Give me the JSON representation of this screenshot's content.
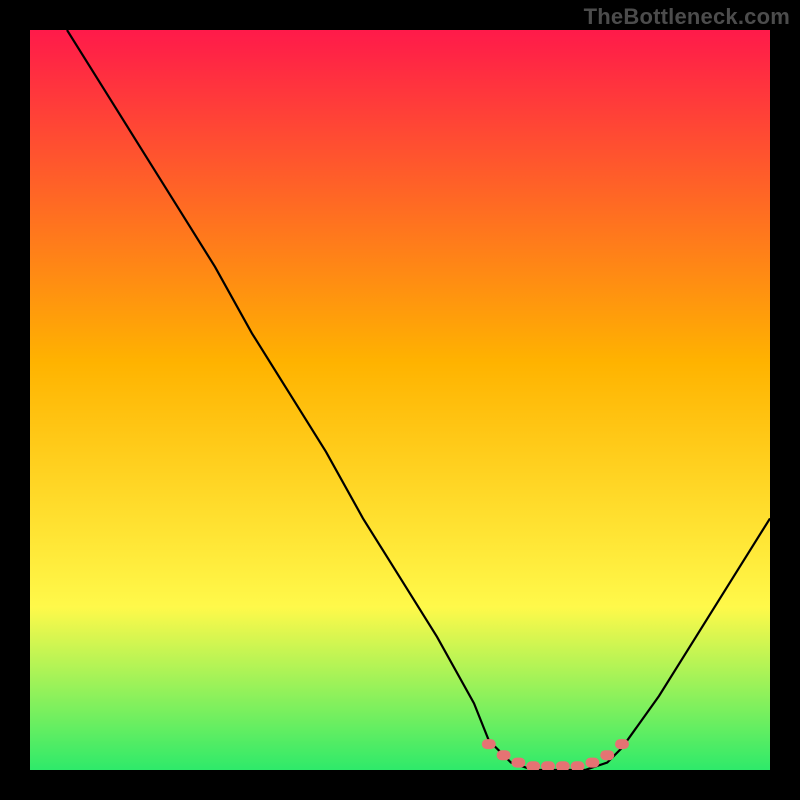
{
  "watermark": "TheBottleneck.com",
  "chart_data": {
    "type": "line",
    "title": "",
    "xlabel": "",
    "ylabel": "",
    "xlim": [
      0,
      100
    ],
    "ylim": [
      0,
      100
    ],
    "grid": false,
    "legend": false,
    "background_gradient": {
      "top": "#ff1a4a",
      "mid1": "#ffb300",
      "mid2": "#fff94a",
      "bottom": "#2eea6a"
    },
    "series": [
      {
        "name": "bottleneck-curve",
        "color": "#000000",
        "x": [
          5,
          10,
          15,
          20,
          25,
          30,
          35,
          40,
          45,
          50,
          55,
          60,
          62,
          65,
          68,
          72,
          75,
          78,
          80,
          85,
          90,
          95,
          100
        ],
        "y": [
          100,
          92,
          84,
          76,
          68,
          59,
          51,
          43,
          34,
          26,
          18,
          9,
          4,
          1,
          0,
          0,
          0,
          1,
          3,
          10,
          18,
          26,
          34
        ]
      }
    ],
    "markers": {
      "name": "optimal-range-dots",
      "color": "#e57373",
      "x": [
        62,
        64,
        66,
        68,
        70,
        72,
        74,
        76,
        78,
        80
      ],
      "y": [
        3.5,
        2,
        1,
        0.5,
        0.5,
        0.5,
        0.5,
        1,
        2,
        3.5
      ]
    }
  }
}
